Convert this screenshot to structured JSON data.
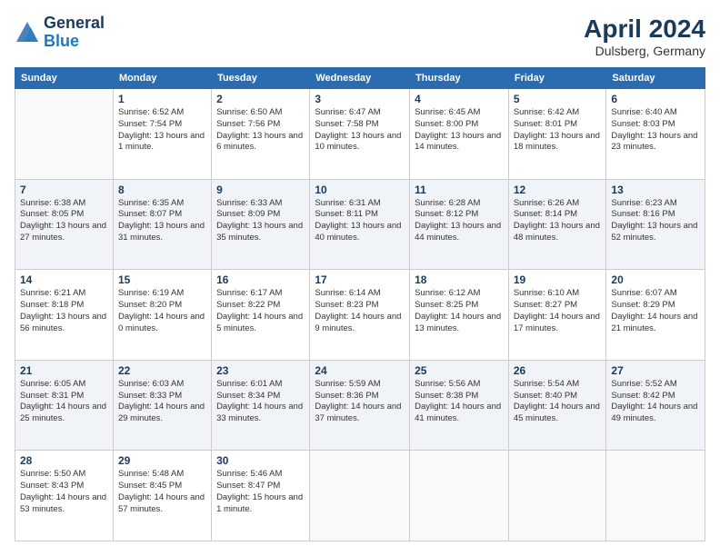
{
  "header": {
    "logo_line1": "General",
    "logo_line2": "Blue",
    "title": "April 2024",
    "subtitle": "Dulsberg, Germany"
  },
  "columns": [
    "Sunday",
    "Monday",
    "Tuesday",
    "Wednesday",
    "Thursday",
    "Friday",
    "Saturday"
  ],
  "weeks": [
    [
      {
        "day": "",
        "sunrise": "",
        "sunset": "",
        "daylight": ""
      },
      {
        "day": "1",
        "sunrise": "Sunrise: 6:52 AM",
        "sunset": "Sunset: 7:54 PM",
        "daylight": "Daylight: 13 hours and 1 minute."
      },
      {
        "day": "2",
        "sunrise": "Sunrise: 6:50 AM",
        "sunset": "Sunset: 7:56 PM",
        "daylight": "Daylight: 13 hours and 6 minutes."
      },
      {
        "day": "3",
        "sunrise": "Sunrise: 6:47 AM",
        "sunset": "Sunset: 7:58 PM",
        "daylight": "Daylight: 13 hours and 10 minutes."
      },
      {
        "day": "4",
        "sunrise": "Sunrise: 6:45 AM",
        "sunset": "Sunset: 8:00 PM",
        "daylight": "Daylight: 13 hours and 14 minutes."
      },
      {
        "day": "5",
        "sunrise": "Sunrise: 6:42 AM",
        "sunset": "Sunset: 8:01 PM",
        "daylight": "Daylight: 13 hours and 18 minutes."
      },
      {
        "day": "6",
        "sunrise": "Sunrise: 6:40 AM",
        "sunset": "Sunset: 8:03 PM",
        "daylight": "Daylight: 13 hours and 23 minutes."
      }
    ],
    [
      {
        "day": "7",
        "sunrise": "Sunrise: 6:38 AM",
        "sunset": "Sunset: 8:05 PM",
        "daylight": "Daylight: 13 hours and 27 minutes."
      },
      {
        "day": "8",
        "sunrise": "Sunrise: 6:35 AM",
        "sunset": "Sunset: 8:07 PM",
        "daylight": "Daylight: 13 hours and 31 minutes."
      },
      {
        "day": "9",
        "sunrise": "Sunrise: 6:33 AM",
        "sunset": "Sunset: 8:09 PM",
        "daylight": "Daylight: 13 hours and 35 minutes."
      },
      {
        "day": "10",
        "sunrise": "Sunrise: 6:31 AM",
        "sunset": "Sunset: 8:11 PM",
        "daylight": "Daylight: 13 hours and 40 minutes."
      },
      {
        "day": "11",
        "sunrise": "Sunrise: 6:28 AM",
        "sunset": "Sunset: 8:12 PM",
        "daylight": "Daylight: 13 hours and 44 minutes."
      },
      {
        "day": "12",
        "sunrise": "Sunrise: 6:26 AM",
        "sunset": "Sunset: 8:14 PM",
        "daylight": "Daylight: 13 hours and 48 minutes."
      },
      {
        "day": "13",
        "sunrise": "Sunrise: 6:23 AM",
        "sunset": "Sunset: 8:16 PM",
        "daylight": "Daylight: 13 hours and 52 minutes."
      }
    ],
    [
      {
        "day": "14",
        "sunrise": "Sunrise: 6:21 AM",
        "sunset": "Sunset: 8:18 PM",
        "daylight": "Daylight: 13 hours and 56 minutes."
      },
      {
        "day": "15",
        "sunrise": "Sunrise: 6:19 AM",
        "sunset": "Sunset: 8:20 PM",
        "daylight": "Daylight: 14 hours and 0 minutes."
      },
      {
        "day": "16",
        "sunrise": "Sunrise: 6:17 AM",
        "sunset": "Sunset: 8:22 PM",
        "daylight": "Daylight: 14 hours and 5 minutes."
      },
      {
        "day": "17",
        "sunrise": "Sunrise: 6:14 AM",
        "sunset": "Sunset: 8:23 PM",
        "daylight": "Daylight: 14 hours and 9 minutes."
      },
      {
        "day": "18",
        "sunrise": "Sunrise: 6:12 AM",
        "sunset": "Sunset: 8:25 PM",
        "daylight": "Daylight: 14 hours and 13 minutes."
      },
      {
        "day": "19",
        "sunrise": "Sunrise: 6:10 AM",
        "sunset": "Sunset: 8:27 PM",
        "daylight": "Daylight: 14 hours and 17 minutes."
      },
      {
        "day": "20",
        "sunrise": "Sunrise: 6:07 AM",
        "sunset": "Sunset: 8:29 PM",
        "daylight": "Daylight: 14 hours and 21 minutes."
      }
    ],
    [
      {
        "day": "21",
        "sunrise": "Sunrise: 6:05 AM",
        "sunset": "Sunset: 8:31 PM",
        "daylight": "Daylight: 14 hours and 25 minutes."
      },
      {
        "day": "22",
        "sunrise": "Sunrise: 6:03 AM",
        "sunset": "Sunset: 8:33 PM",
        "daylight": "Daylight: 14 hours and 29 minutes."
      },
      {
        "day": "23",
        "sunrise": "Sunrise: 6:01 AM",
        "sunset": "Sunset: 8:34 PM",
        "daylight": "Daylight: 14 hours and 33 minutes."
      },
      {
        "day": "24",
        "sunrise": "Sunrise: 5:59 AM",
        "sunset": "Sunset: 8:36 PM",
        "daylight": "Daylight: 14 hours and 37 minutes."
      },
      {
        "day": "25",
        "sunrise": "Sunrise: 5:56 AM",
        "sunset": "Sunset: 8:38 PM",
        "daylight": "Daylight: 14 hours and 41 minutes."
      },
      {
        "day": "26",
        "sunrise": "Sunrise: 5:54 AM",
        "sunset": "Sunset: 8:40 PM",
        "daylight": "Daylight: 14 hours and 45 minutes."
      },
      {
        "day": "27",
        "sunrise": "Sunrise: 5:52 AM",
        "sunset": "Sunset: 8:42 PM",
        "daylight": "Daylight: 14 hours and 49 minutes."
      }
    ],
    [
      {
        "day": "28",
        "sunrise": "Sunrise: 5:50 AM",
        "sunset": "Sunset: 8:43 PM",
        "daylight": "Daylight: 14 hours and 53 minutes."
      },
      {
        "day": "29",
        "sunrise": "Sunrise: 5:48 AM",
        "sunset": "Sunset: 8:45 PM",
        "daylight": "Daylight: 14 hours and 57 minutes."
      },
      {
        "day": "30",
        "sunrise": "Sunrise: 5:46 AM",
        "sunset": "Sunset: 8:47 PM",
        "daylight": "Daylight: 15 hours and 1 minute."
      },
      {
        "day": "",
        "sunrise": "",
        "sunset": "",
        "daylight": ""
      },
      {
        "day": "",
        "sunrise": "",
        "sunset": "",
        "daylight": ""
      },
      {
        "day": "",
        "sunrise": "",
        "sunset": "",
        "daylight": ""
      },
      {
        "day": "",
        "sunrise": "",
        "sunset": "",
        "daylight": ""
      }
    ]
  ]
}
